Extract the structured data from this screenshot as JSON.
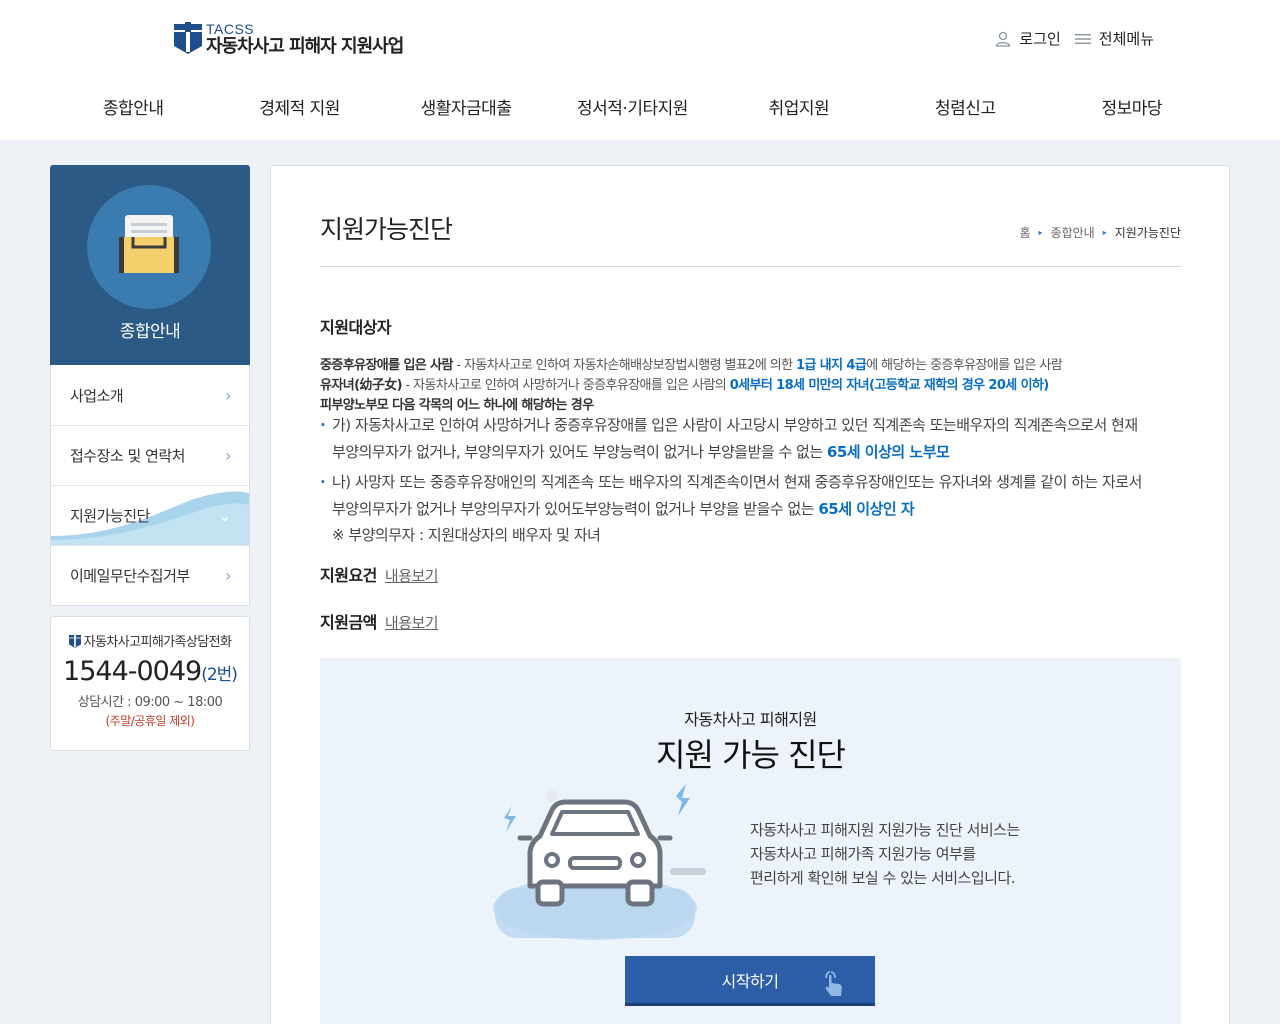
{
  "header": {
    "logo_sub": "TACSS",
    "logo_main": "자동차사고 피해자 지원사업",
    "login": "로그인",
    "menu_all": "전체메뉴",
    "gnb": [
      "종합안내",
      "경제적 지원",
      "생활자금대출",
      "정서적·기타지원",
      "취업지원",
      "청렴신고",
      "정보마당"
    ]
  },
  "sidebar": {
    "title": "종합안내",
    "items": [
      {
        "label": "사업소개"
      },
      {
        "label": "접수장소 및 연락처"
      },
      {
        "label": "지원가능진단",
        "active": true
      },
      {
        "label": "이메일무단수집거부"
      }
    ],
    "call": {
      "label": "자동차사고피해가족상담전화",
      "number": "1544-0049",
      "ext": "(2번)",
      "hours": "상담시간 : 09:00 ~ 18:00",
      "note": "(주말/공휴일 제외)"
    }
  },
  "page": {
    "title": "지원가능진단",
    "breadcrumb": [
      "홈",
      "종합안내",
      "지원가능진단"
    ]
  },
  "target": {
    "heading": "지원대상자",
    "line1": {
      "bold": "중증후유장애를 입은 사람",
      "pre": " - 자동차사고로 인하여 자동차손해배상보장법시행령 별표2에 의한 ",
      "hl": "1급 내지 4급",
      "post": "에 해당하는 중증후유장애를 입은 사람"
    },
    "line2": {
      "bold": "유자녀(幼子女)",
      "pre": " - 자동차사고로 인하여 사망하거나 중증후유장애를 입은 사람의 ",
      "hl": "0세부터 18세 미만의 자녀(고등학교 재학의 경우 20세 이하)"
    },
    "line3": {
      "bold": "피부양노부모 다음 각목의 어느 하나에 해당하는 경우"
    },
    "bullet1": {
      "text1": "가) 자동차사고로 인하여 사망하거나 중증후유장애를 입은 사람이 사고당시 부양하고 있던 직계존속 또는배우자의 직계존속으로서 현재",
      "text2": "부양의무자가 없거나, 부양의무자가 있어도 부양능력이 없거나 부양을받을 수 없는 ",
      "hl": "65세 이상의 노부모"
    },
    "bullet2": {
      "text1": "나) 사망자 또는 중증후유장애인의 직계존속 또는 배우자의 직계존속이면서 현재 중증후유장애인또는 유자녀와 생계를 같이 하는 자로서",
      "text2": "부양의무자가 없거나 부양의무자가 있어도부양능력이 없거나 부양을 받을수 없는 ",
      "hl": "65세 이상인 자"
    },
    "note": "※ 부양의무자 : 지원대상자의 배우자 및 자녀"
  },
  "requirements": {
    "label": "지원요건",
    "link": "내용보기"
  },
  "amount": {
    "label": "지원금액",
    "link": "내용보기"
  },
  "diagnosis": {
    "subtitle": "자동차사고 피해지원",
    "title": "지원 가능 진단",
    "desc": [
      "자동차사고 피해지원 지원가능 진단 서비스는",
      "자동차사고 피해가족 지원가능 여부를",
      "편리하게 확인해 보실 수 있는 서비스입니다."
    ],
    "button": "시작하기"
  },
  "colors": {
    "brand": "#1f4e8c",
    "sidebar_head": "#2b5a85",
    "highlight": "#0a6ec4",
    "button": "#2d5ea8"
  }
}
